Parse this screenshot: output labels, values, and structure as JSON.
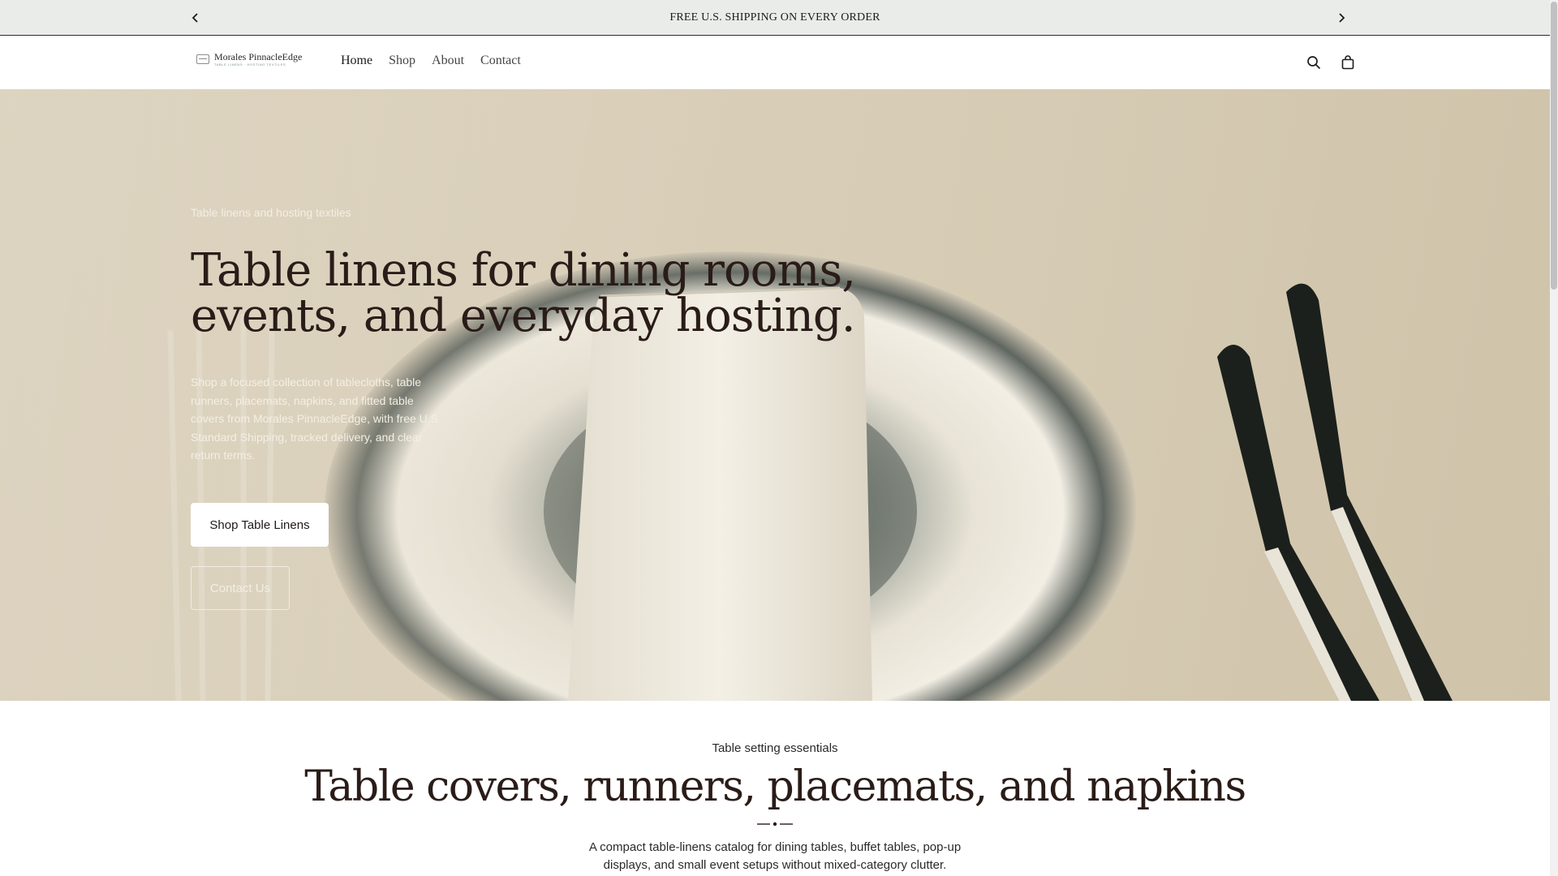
{
  "announcement": {
    "text": "FREE U.S. SHIPPING ON EVERY ORDER",
    "prev_icon": "chevron-left-icon",
    "next_icon": "chevron-right-icon"
  },
  "header": {
    "logo": {
      "name": "Morales PinnacleEdge",
      "tagline": "TABLE LINENS · HOSTING TEXTILES"
    },
    "nav": [
      {
        "label": "Home",
        "active": true
      },
      {
        "label": "Shop",
        "active": false
      },
      {
        "label": "About",
        "active": false
      },
      {
        "label": "Contact",
        "active": false
      }
    ],
    "search_icon": "search-icon",
    "cart_icon": "shopping-bag-icon"
  },
  "hero": {
    "eyebrow": "Table linens and hosting textiles",
    "title": "Table linens for dining rooms, events, and everyday hosting.",
    "description": "Shop a focused collection of tablecloths, table runners, placemats, napkins, and fitted table covers from Morales PinnacleEdge, with free U.S. Standard Shipping, tracked delivery, and clear return terms.",
    "primary_cta": "Shop Table Linens",
    "secondary_cta": "Contact Us"
  },
  "section": {
    "eyebrow": "Table setting essentials",
    "title": "Table covers, runners, placemats, and napkins",
    "description": "A compact table-linens catalog for dining tables, buffet tables, pop-up displays, and small event setups without mixed-category clutter."
  },
  "colors": {
    "announcement_bg": "#e9ece9",
    "heading": "#2a1c18",
    "hero_bg": "#d9cfb9"
  }
}
